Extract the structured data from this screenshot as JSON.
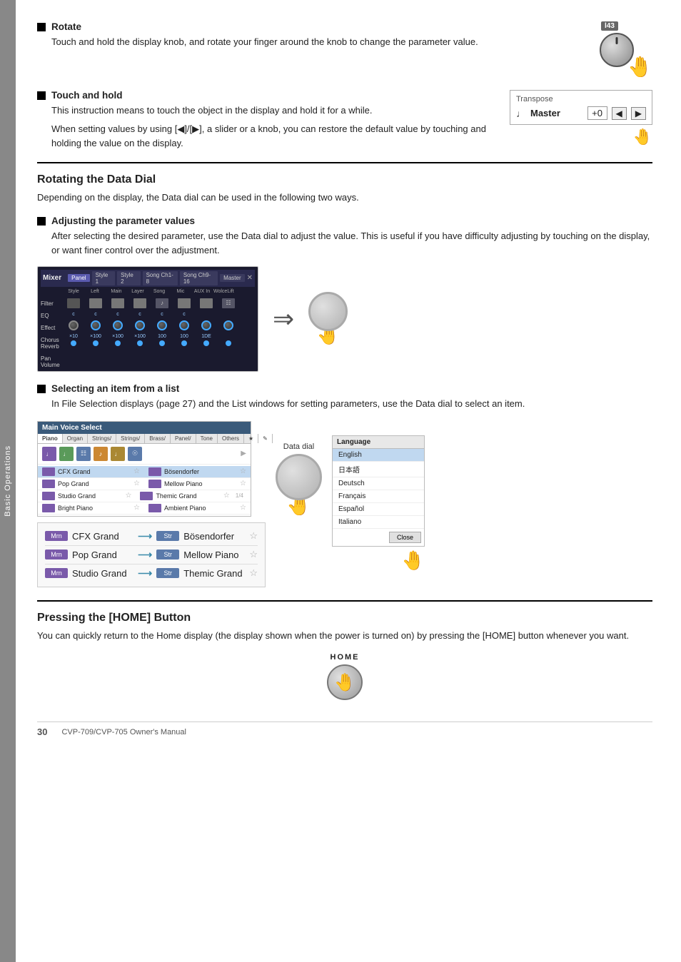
{
  "sidebar": {
    "label": "Basic Operations"
  },
  "page_number": "30",
  "footer_text": "CVP-709/CVP-705 Owner's Manual",
  "sections": {
    "rotate": {
      "title": "Rotate",
      "body1": "Touch and hold the display knob, and rotate your finger around the knob to change the parameter value.",
      "knob_num": "l43"
    },
    "touch_and_hold": {
      "title": "Touch and hold",
      "body1": "This instruction means to touch the object in the display and hold it for a while.",
      "body2": "When setting values by using [◀]/[▶], a slider or a knob, you can restore the default value by touching and holding the value on the display.",
      "transpose_title": "Transpose",
      "transpose_label": "Master",
      "transpose_icon": "♩",
      "transpose_value": "+0"
    },
    "rotating_data_dial": {
      "title": "Rotating the Data Dial",
      "desc": "Depending on the display, the Data dial can be used in the following two ways.",
      "adjusting": {
        "title": "Adjusting the parameter values",
        "body": "After selecting the desired parameter, use the Data dial to adjust the value. This is useful if you have difficulty adjusting by touching on the display, or want finer control over the adjustment."
      },
      "selecting": {
        "title": "Selecting an item from a list",
        "body": "In File Selection displays (page 27) and the List windows for setting parameters, use the Data dial to select an item."
      }
    },
    "pressing_home": {
      "title": "Pressing the [HOME] Button",
      "desc": "You can quickly return to the Home display (the display shown when the power is turned on) by pressing the [HOME] button whenever you want.",
      "home_label": "HOME"
    }
  },
  "mixer": {
    "title": "Mixer",
    "tabs": [
      "Panel",
      "Style 1",
      "Style 2",
      "Song Ch1-8",
      "Song Ch9-16",
      "Master"
    ],
    "row_tabs": [
      "Style",
      "Left",
      "Main",
      "Layer",
      "Song",
      "Mic",
      "AUX In",
      "VoiceLift"
    ],
    "labels": [
      "Filter",
      "EQ",
      "Effect",
      "Chorus",
      "Reverb",
      "Pan",
      "Volume"
    ],
    "values": [
      "×10",
      "×100",
      "×100",
      "×100",
      "100",
      "100",
      "1DE"
    ]
  },
  "voice_select": {
    "title": "Main Voice Select",
    "items": [
      {
        "badge": "Mrn",
        "name": "CFX Grand",
        "badge2": "Str",
        "name2": "Bösendorfer"
      },
      {
        "badge": "Mrn",
        "name": "Pop Grand",
        "badge2": "Str",
        "name2": "Mellow Piano"
      },
      {
        "badge": "Mrn",
        "name": "Studio Grand",
        "badge2": "Str",
        "name2": "Themic Grand"
      },
      {
        "badge": "Mrn",
        "name": "Bright Piano",
        "badge2": "Str",
        "name2": "Ambient Piano"
      }
    ]
  },
  "voice_select_big": {
    "items": [
      {
        "badge": "Mrn",
        "name": "CFX Grand",
        "badge2": "Str",
        "name2": "Bösendorfer"
      },
      {
        "badge": "Mrn",
        "name": "Pop Grand",
        "badge2": "Str",
        "name2": "Mellow Piano"
      },
      {
        "badge": "Mrn",
        "name": "Studio Grand",
        "badge2": "Str",
        "name2": "Themic Grand"
      }
    ]
  },
  "language_list": {
    "title": "Language",
    "items": [
      "English",
      "日本語",
      "Deutsch",
      "Français",
      "Español",
      "Italiano"
    ],
    "selected": "English",
    "close_label": "Close"
  },
  "data_dial_label": "Data dial"
}
